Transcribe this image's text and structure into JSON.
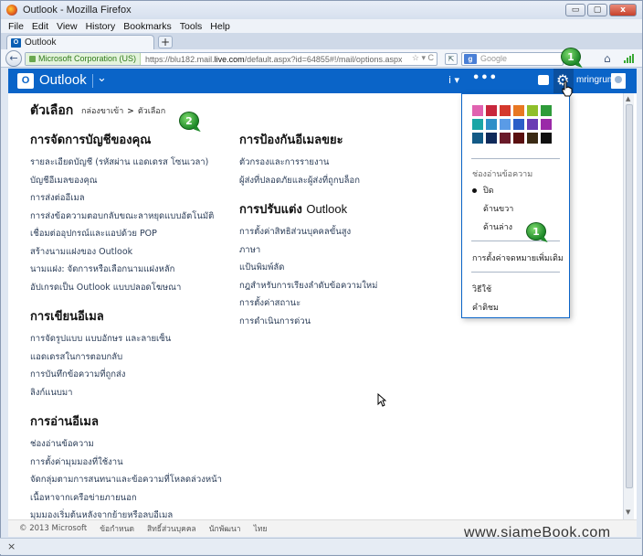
{
  "window": {
    "title": "Outlook - Mozilla Firefox",
    "min_glyph": "▭",
    "max_glyph": "▢",
    "close_glyph": "x"
  },
  "menu": [
    "File",
    "Edit",
    "View",
    "History",
    "Bookmarks",
    "Tools",
    "Help"
  ],
  "tab": {
    "label": "Outlook",
    "icon_letter": "O",
    "new_tab": "+"
  },
  "nav": {
    "back_glyph": "←",
    "site_identity": "Microsoft Corporation (US)",
    "url_prefix": "https://blu182.mail.",
    "url_domain": "live.com",
    "url_rest": "/default.aspx?id=64855#!/mail/options.aspx",
    "url_controls": "☆ ▾ C",
    "search_placeholder": "Google",
    "search_icon_letter": "g"
  },
  "outlook": {
    "logo_letter": "O",
    "title": "Outlook",
    "chevron": "⌄",
    "info_glyph": "i ▾",
    "dots": "•••",
    "gear_glyph": "⚙",
    "username": "mringrum"
  },
  "page": {
    "title": "ตัวเลือก",
    "breadcrumb_home": "กล่องขาเข้า",
    "breadcrumb_sep": ">",
    "breadcrumb_current": "ตัวเลือก"
  },
  "col1": [
    {
      "heading": "การจัดการบัญชีของคุณ",
      "links": [
        "รายละเอียดบัญชี (รหัสผ่าน แอดเดรส โซนเวลา)",
        "บัญชีอีเมลของคุณ",
        "การส่งต่ออีเมล",
        "การส่งข้อความตอบกลับขณะลาหยุดแบบอัตโนมัติ",
        "เชื่อมต่ออุปกรณ์และแอปด้วย POP",
        "สร้างนามแฝงของ Outlook",
        "นามแฝง: จัดการหรือเลือกนามแฝงหลัก",
        "อัปเกรดเป็น Outlook แบบปลอดโฆษณา"
      ]
    },
    {
      "heading": "การเขียนอีเมล",
      "links": [
        "การจัดรูปแบบ แบบอักษร และลายเซ็น",
        "แอดเดรสในการตอบกลับ",
        "การบันทึกข้อความที่ถูกส่ง",
        "ลิงก์แนบมา"
      ]
    },
    {
      "heading": "การอ่านอีเมล",
      "links": [
        "ช่องอ่านข้อความ",
        "การตั้งค่ามุมมองที่ใช้งาน",
        "จัดกลุ่มตามการสนทนาและข้อความที่โหลดล่วงหน้า",
        "เนื้อหาจากเครือข่ายภายนอก",
        "มุมมองเริ่มต้นหลังจากย้ายหรือลบอีเมล"
      ]
    }
  ],
  "col2": [
    {
      "heading": "การป้องกันอีเมลขยะ",
      "links": [
        "ตัวกรองและการรายงาน",
        "ผู้ส่งที่ปลอดภัยและผู้ส่งที่ถูกบล็อก"
      ]
    },
    {
      "heading": "การปรับแต่ง",
      "heading_light": "Outlook",
      "links": [
        "การตั้งค่าสิทธิส่วนบุคคลขั้นสูง",
        "ภาษา",
        "แป้นพิมพ์ลัด",
        "กฎสำหรับการเรียงลำดับข้อความใหม่",
        "การตั้งค่าสถานะ",
        "การดำเนินการด่วน"
      ]
    }
  ],
  "dropdown": {
    "swatches": [
      "#e062b0",
      "#c8263c",
      "#d4382c",
      "#e87722",
      "#8fbf2a",
      "#2e9b3a",
      "#1aa6a6",
      "#2f8fc8",
      "#5a9be6",
      "#2a5ec8",
      "#6a3cb4",
      "#9a2aa8",
      "#135a86",
      "#102a5a",
      "#6a1a2a",
      "#5a1010",
      "#3a2a14",
      "#111111"
    ],
    "reading_pane_heading": "ช่องอ่านข้อความ",
    "options": [
      "ปิด",
      "ด้านขวา",
      "ด้านล่าง"
    ],
    "more_settings": "การตั้งค่าจดหมายเพิ่มเติม",
    "help": "วิธีใช้",
    "feedback": "คำติชม"
  },
  "footer": [
    "© 2013 Microsoft",
    "ข้อกำหนด",
    "สิทธิ์ส่วนบุคคล",
    "นักพัฒนา",
    "ไทย"
  ],
  "status": {
    "close_glyph": "×"
  },
  "watermark": "www.siameBook.com",
  "callouts": {
    "one": "1",
    "two": "2"
  }
}
